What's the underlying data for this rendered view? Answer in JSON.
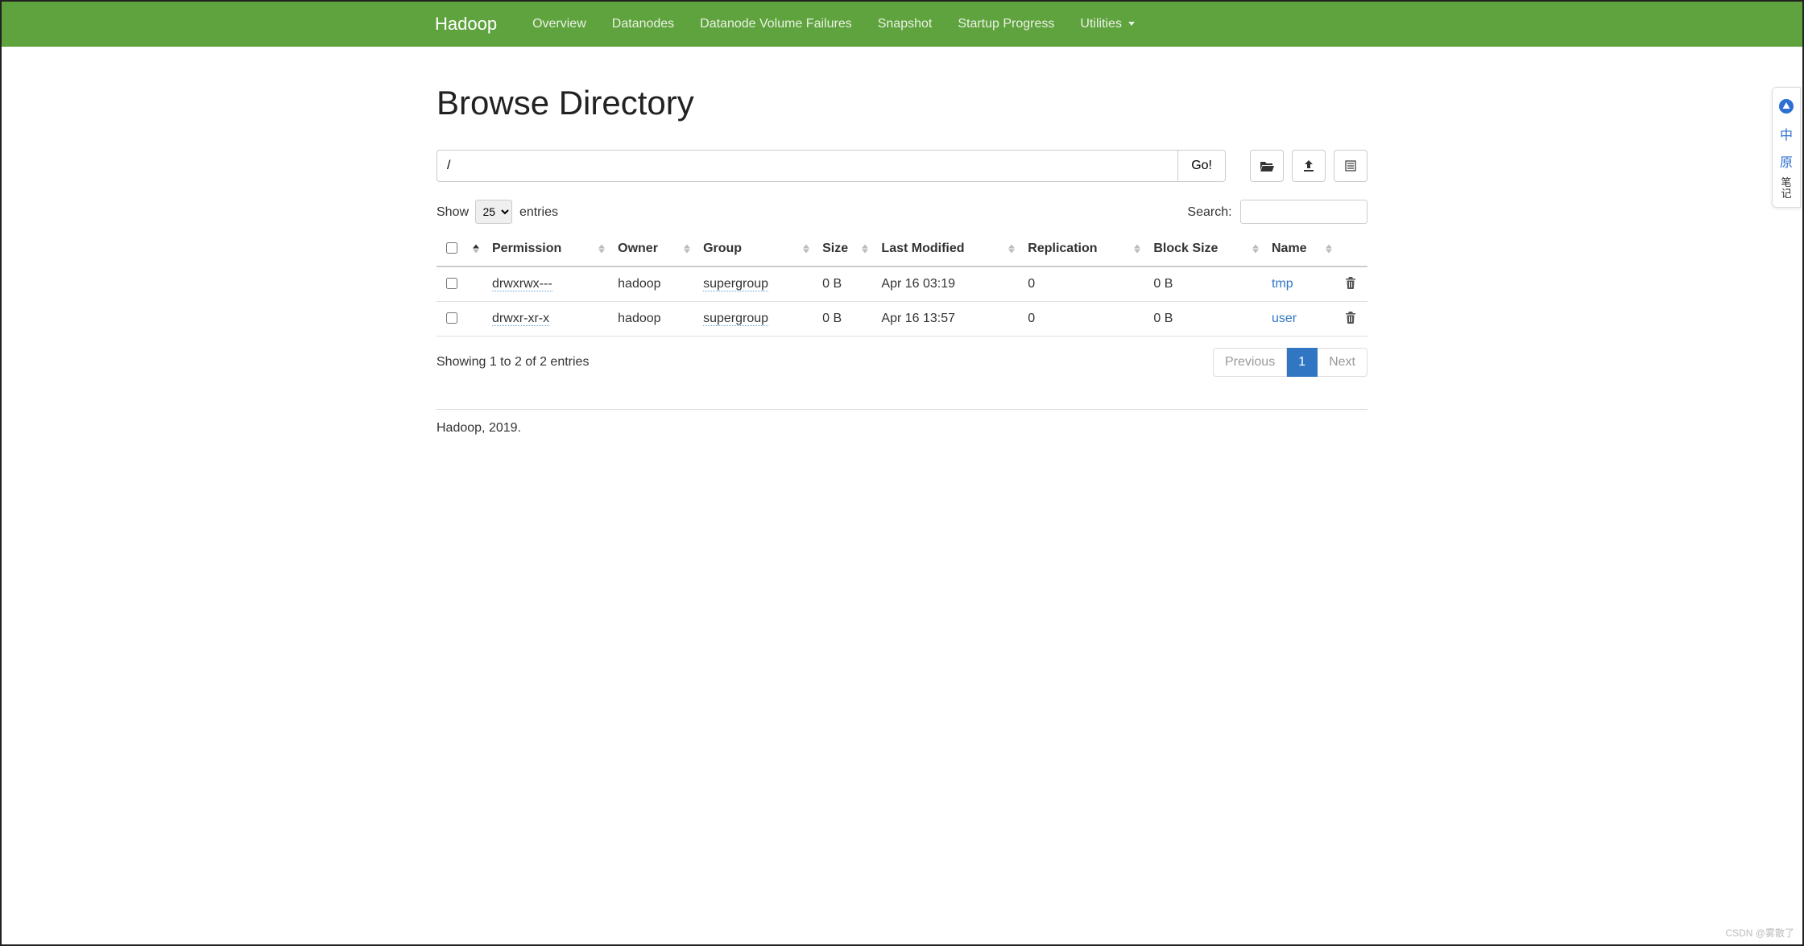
{
  "nav": {
    "brand": "Hadoop",
    "links": [
      "Overview",
      "Datanodes",
      "Datanode Volume Failures",
      "Snapshot",
      "Startup Progress"
    ],
    "utilities_label": "Utilities"
  },
  "page": {
    "title": "Browse Directory"
  },
  "path": {
    "value": "/",
    "go_label": "Go!"
  },
  "toolbar": {
    "open_icon": "open-folder",
    "upload_icon": "upload",
    "newdir_icon": "new-folder"
  },
  "entries": {
    "show_label_pre": "Show",
    "show_label_post": "entries",
    "show_value": "25",
    "search_label": "Search:",
    "search_value": ""
  },
  "columns": [
    "Permission",
    "Owner",
    "Group",
    "Size",
    "Last Modified",
    "Replication",
    "Block Size",
    "Name"
  ],
  "rows": [
    {
      "permission": "drwxrwx---",
      "owner": "hadoop",
      "group": "supergroup",
      "size": "0 B",
      "modified": "Apr 16 03:19",
      "replication": "0",
      "block_size": "0 B",
      "name": "tmp"
    },
    {
      "permission": "drwxr-xr-x",
      "owner": "hadoop",
      "group": "supergroup",
      "size": "0 B",
      "modified": "Apr 16 13:57",
      "replication": "0",
      "block_size": "0 B",
      "name": "user"
    }
  ],
  "info": "Showing 1 to 2 of 2 entries",
  "pagination": {
    "previous": "Previous",
    "next": "Next",
    "current": "1"
  },
  "footer": "Hadoop, 2019.",
  "side": {
    "c1": "中",
    "c2": "原",
    "c3": "笔\n记"
  },
  "watermark": "CSDN @雾散了"
}
